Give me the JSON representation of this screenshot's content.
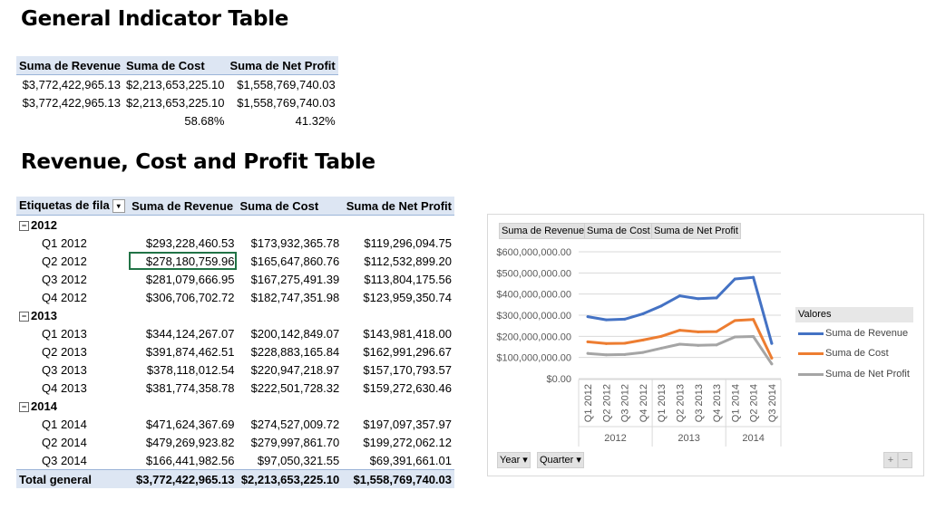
{
  "titles": {
    "general": "General Indicator Table",
    "revenue": "Revenue, Cost and Profit Table"
  },
  "general_table": {
    "headers": [
      "Suma de Revenue",
      "Suma de Cost",
      "Suma de Net Profit"
    ],
    "rows": [
      [
        "$3,772,422,965.13",
        "$2,213,653,225.10",
        "$1,558,769,740.03"
      ],
      [
        "$3,772,422,965.13",
        "$2,213,653,225.10",
        "$1,558,769,740.03"
      ],
      [
        "",
        "58.68%",
        "41.32%"
      ]
    ]
  },
  "pivot": {
    "headers": [
      "Etiquetas de fila",
      "Suma de Revenue",
      "Suma de Cost",
      "Suma de Net Profit"
    ],
    "filter_glyph": "▾",
    "collapse_glyph": "−",
    "years": [
      {
        "year": "2012",
        "rows": [
          [
            "Q1 2012",
            "$293,228,460.53",
            "$173,932,365.78",
            "$119,296,094.75"
          ],
          [
            "Q2 2012",
            "$278,180,759.96",
            "$165,647,860.76",
            "$112,532,899.20"
          ],
          [
            "Q3 2012",
            "$281,079,666.95",
            "$167,275,491.39",
            "$113,804,175.56"
          ],
          [
            "Q4 2012",
            "$306,706,702.72",
            "$182,747,351.98",
            "$123,959,350.74"
          ]
        ]
      },
      {
        "year": "2013",
        "rows": [
          [
            "Q1 2013",
            "$344,124,267.07",
            "$200,142,849.07",
            "$143,981,418.00"
          ],
          [
            "Q2 2013",
            "$391,874,462.51",
            "$228,883,165.84",
            "$162,991,296.67"
          ],
          [
            "Q3 2013",
            "$378,118,012.54",
            "$220,947,218.97",
            "$157,170,793.57"
          ],
          [
            "Q4 2013",
            "$381,774,358.78",
            "$222,501,728.32",
            "$159,272,630.46"
          ]
        ]
      },
      {
        "year": "2014",
        "rows": [
          [
            "Q1 2014",
            "$471,624,367.69",
            "$274,527,009.72",
            "$197,097,357.97"
          ],
          [
            "Q2 2014",
            "$479,269,923.82",
            "$279,997,861.70",
            "$199,272,062.12"
          ],
          [
            "Q3 2014",
            "$166,441,982.56",
            "$97,050,321.55",
            "$69,391,661.01"
          ]
        ]
      }
    ],
    "total": [
      "Total general",
      "$3,772,422,965.13",
      "$2,213,653,225.10",
      "$1,558,769,740.03"
    ]
  },
  "chart_ui": {
    "field_buttons": [
      "Suma de Revenue",
      "Suma de Cost",
      "Suma de Net Profit"
    ],
    "axis_buttons": [
      "Year ▾",
      "Quarter ▾"
    ],
    "legend_title": "Valores",
    "zoom_buttons": [
      "+",
      "−"
    ]
  },
  "chart_data": {
    "type": "line",
    "categories": [
      "Q1 2012",
      "Q2 2012",
      "Q3 2012",
      "Q4 2012",
      "Q1 2013",
      "Q2 2013",
      "Q3 2013",
      "Q4 2013",
      "Q1 2014",
      "Q2 2014",
      "Q3 2014"
    ],
    "groups": [
      {
        "label": "2012",
        "count": 4
      },
      {
        "label": "2013",
        "count": 4
      },
      {
        "label": "2014",
        "count": 3
      }
    ],
    "y_ticks": [
      "$0.00",
      "$100,000,000.00",
      "$200,000,000.00",
      "$300,000,000.00",
      "$400,000,000.00",
      "$500,000,000.00",
      "$600,000,000.00"
    ],
    "ylim": [
      0,
      600000000
    ],
    "grid": true,
    "legend": "right",
    "series": [
      {
        "name": "Suma de Revenue",
        "color": "#4472c4",
        "values": [
          293228460.53,
          278180759.96,
          281079666.95,
          306706702.72,
          344124267.07,
          391874462.51,
          378118012.54,
          381774358.78,
          471624367.69,
          479269923.82,
          166441982.56
        ]
      },
      {
        "name": "Suma de Cost",
        "color": "#ed7d31",
        "values": [
          173932365.78,
          165647860.76,
          167275491.39,
          182747351.98,
          200142849.07,
          228883165.84,
          220947218.97,
          222501728.32,
          274527009.72,
          279997861.7,
          97050321.55
        ]
      },
      {
        "name": "Suma de Net Profit",
        "color": "#a5a5a5",
        "values": [
          119296094.75,
          112532899.2,
          113804175.56,
          123959350.74,
          143981418.0,
          162991296.67,
          157170793.57,
          159272630.46,
          197097357.97,
          199272062.12,
          69391661.01
        ]
      }
    ]
  }
}
